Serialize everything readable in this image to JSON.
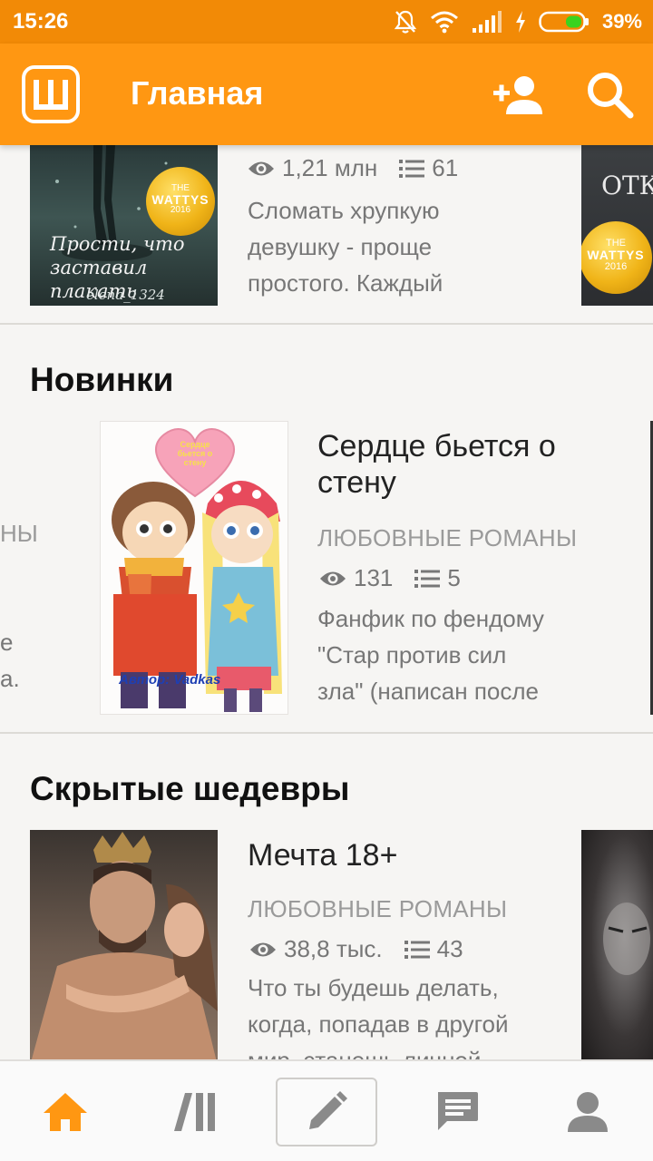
{
  "status_bar": {
    "time": "15:26",
    "battery": "39%"
  },
  "app_bar": {
    "logo_letter": "Ш",
    "title": "Главная"
  },
  "featured_row": {
    "cover_text": "Прости, что заставил плакать",
    "cover_author": "elena_1324",
    "badge": {
      "line1": "THE",
      "line2": "WATTYS",
      "line3": "2016"
    },
    "views": "1,21 млн",
    "parts": "61",
    "desc_lines": [
      "Сломать хрупкую",
      "девушку - проще",
      "простого. Каждый"
    ],
    "next_cover_text": "ОТК"
  },
  "new_section": {
    "title": "Новинки",
    "left_partial": [
      "НЫ",
      "е",
      "а."
    ],
    "book": {
      "cover_heart_text": "Сердце бьется о стену",
      "cover_author": "Автор: Vadkas",
      "title_lines": [
        "Сердце бьется о",
        "стену"
      ],
      "genre": "ЛЮБОВНЫЕ РОМАНЫ",
      "views": "131",
      "parts": "5",
      "desc_lines": [
        "Фанфик по фендому",
        "\"Стар против сил",
        "зла\" (написан после"
      ]
    }
  },
  "hidden_section": {
    "title": "Скрытые шедевры",
    "book": {
      "title": "Мечта 18+",
      "genre": "ЛЮБОВНЫЕ РОМАНЫ",
      "views": "38,8 тыс.",
      "parts": "43",
      "desc_lines": [
        "Что ты будешь делать,",
        "когда, попадав в другой",
        "мир, станешь личной"
      ]
    }
  },
  "colors": {
    "accent": "#ff9712",
    "status": "#f28a06",
    "nav_icon": "#8a8a8a"
  },
  "bottom_nav": [
    "home-icon",
    "library-icon",
    "write-icon",
    "messages-icon",
    "profile-icon"
  ]
}
